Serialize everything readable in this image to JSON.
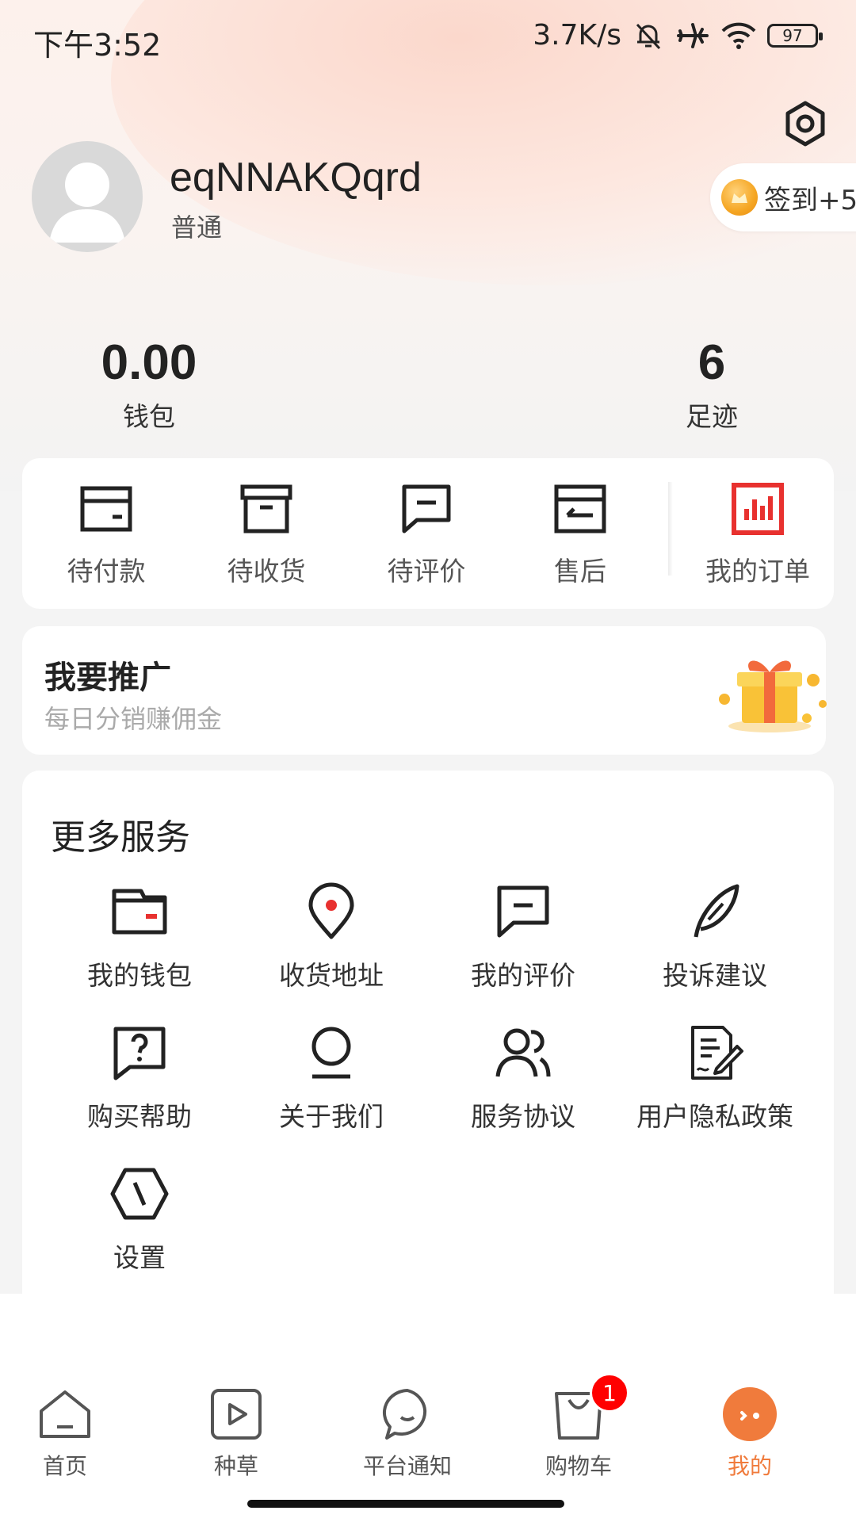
{
  "status_bar": {
    "time": "下午3:52",
    "speed": "3.7K/s",
    "battery": "97"
  },
  "profile": {
    "username": "eqNNAKQqrd",
    "level": "普通",
    "checkin_label": "签到+5"
  },
  "stats": {
    "wallet": {
      "value": "0.00",
      "label": "钱包"
    },
    "footprint": {
      "value": "6",
      "label": "足迹"
    }
  },
  "orders": {
    "items": [
      {
        "label": "待付款",
        "icon": "wallet-card-icon"
      },
      {
        "label": "待收货",
        "icon": "archive-box-icon"
      },
      {
        "label": "待评价",
        "icon": "comment-icon"
      },
      {
        "label": "售后",
        "icon": "return-icon"
      }
    ],
    "all_label": "我的订单",
    "all_icon": "bar-chart-icon",
    "accent": "#e8312f"
  },
  "promo": {
    "title": "我要推广",
    "subtitle": "每日分销赚佣金",
    "image": "gift-box-icon"
  },
  "services": {
    "title": "更多服务",
    "items": [
      {
        "label": "我的钱包",
        "icon": "wallet-icon"
      },
      {
        "label": "收货地址",
        "icon": "location-pin-icon"
      },
      {
        "label": "我的评价",
        "icon": "comment-icon"
      },
      {
        "label": "投诉建议",
        "icon": "feather-icon"
      },
      {
        "label": "购买帮助",
        "icon": "help-icon"
      },
      {
        "label": "关于我们",
        "icon": "person-icon"
      },
      {
        "label": "服务协议",
        "icon": "users-icon"
      },
      {
        "label": "用户隐私政策",
        "icon": "document-sign-icon"
      },
      {
        "label": "设置",
        "icon": "hexagon-settings-icon"
      }
    ]
  },
  "tabbar": {
    "items": [
      {
        "label": "首页",
        "icon": "home-icon"
      },
      {
        "label": "种草",
        "icon": "video-play-icon"
      },
      {
        "label": "平台通知",
        "icon": "chat-bubble-icon"
      },
      {
        "label": "购物车",
        "icon": "shopping-bag-icon",
        "badge": "1"
      },
      {
        "label": "我的",
        "icon": "profile-face-icon",
        "active": true
      }
    ],
    "active_color": "#f07b3c"
  }
}
